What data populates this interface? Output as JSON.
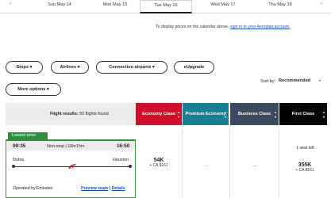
{
  "dates": {
    "prev_arrow": "‹",
    "next_arrow": "›",
    "tabs": [
      "Sun May 14",
      "Mon May 15",
      "Tue May 16",
      "Wed May 17",
      "Thu May 18"
    ],
    "active_index": 2
  },
  "notice": {
    "text": "To display prices on the calendar above,",
    "link": "sign in to your Aeroplan account."
  },
  "filters": {
    "stops": "Stops",
    "airlines": "Airlines",
    "connection_airports": "Connection airports",
    "eupgrade": "eUpgrade",
    "more_options": "More options",
    "caret": "▾"
  },
  "sort": {
    "label": "Sort by:",
    "value": "Recommended",
    "caret": "▾"
  },
  "results_header": {
    "label": "Flight results:",
    "count_text": "50 flights found"
  },
  "cabins": [
    {
      "label": "Economy Class",
      "color": "#d0102a"
    },
    {
      "label": "Premium Economy",
      "color": "#1a7f93"
    },
    {
      "label": "Business Class",
      "color": "#3a4a5f"
    },
    {
      "label": "First Class",
      "color": "#000000"
    }
  ],
  "flight": {
    "badge": "Lowest price",
    "departure_time": "09:35",
    "info": "Non-stop | 16hr15m",
    "arrival_time": "16:50",
    "origin": "Dubai",
    "destination": "Houston",
    "operated_by": "Operated by Emirates",
    "preview_seats": "Preview seats",
    "separator": "|",
    "details": "Details",
    "economy": {
      "points": "54K",
      "cash": "+ CA $161"
    },
    "premium": "...",
    "business": "...",
    "first": {
      "seats_left": "1 seat left",
      "points": "355K",
      "cash": "+ CA $161"
    }
  },
  "accent_green": "#2f8f3e",
  "link_blue": "#1c4db5"
}
